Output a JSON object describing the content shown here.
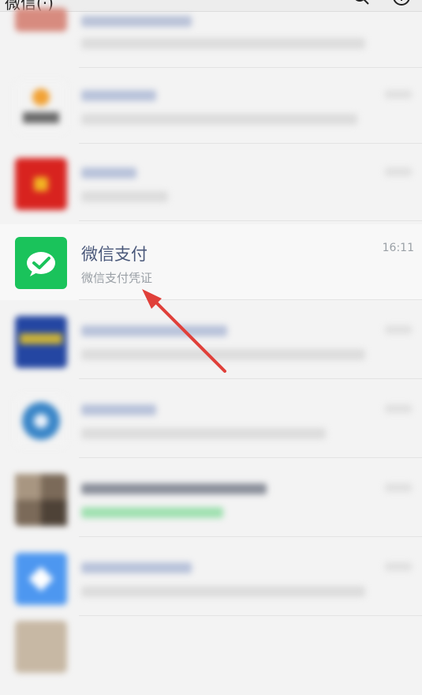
{
  "header": {
    "title": "微信(·)"
  },
  "focus_chat": {
    "name": "微信支付",
    "preview": "微信支付凭证",
    "time": "16:11"
  },
  "colors": {
    "wechat_green": "#1ac35b",
    "annotation_arrow": "#e0403a"
  }
}
